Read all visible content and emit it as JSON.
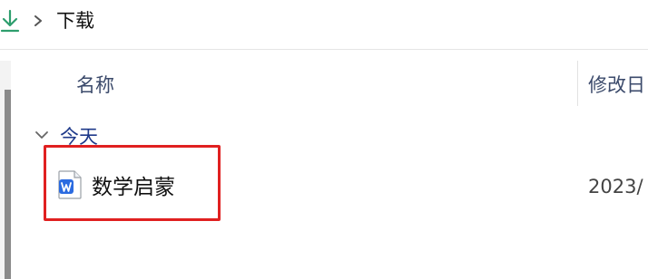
{
  "address_bar": {
    "location_icon": "download-arrow-icon",
    "separator_icon": "chevron-right-icon",
    "current_folder": "下载"
  },
  "columns": {
    "name_header": "名称",
    "date_header": "修改日"
  },
  "groups": [
    {
      "label": "今天",
      "expanded": true,
      "files": [
        {
          "name": "数学启蒙",
          "icon": "wps-word-document-icon",
          "modified": "2023/"
        }
      ]
    }
  ],
  "colors": {
    "accent_green": "#2e9e6e",
    "group_label": "#1f3a8a",
    "header_text": "#3b4a6b",
    "highlight_border": "#e02020",
    "word_blue": "#2b6be0"
  }
}
